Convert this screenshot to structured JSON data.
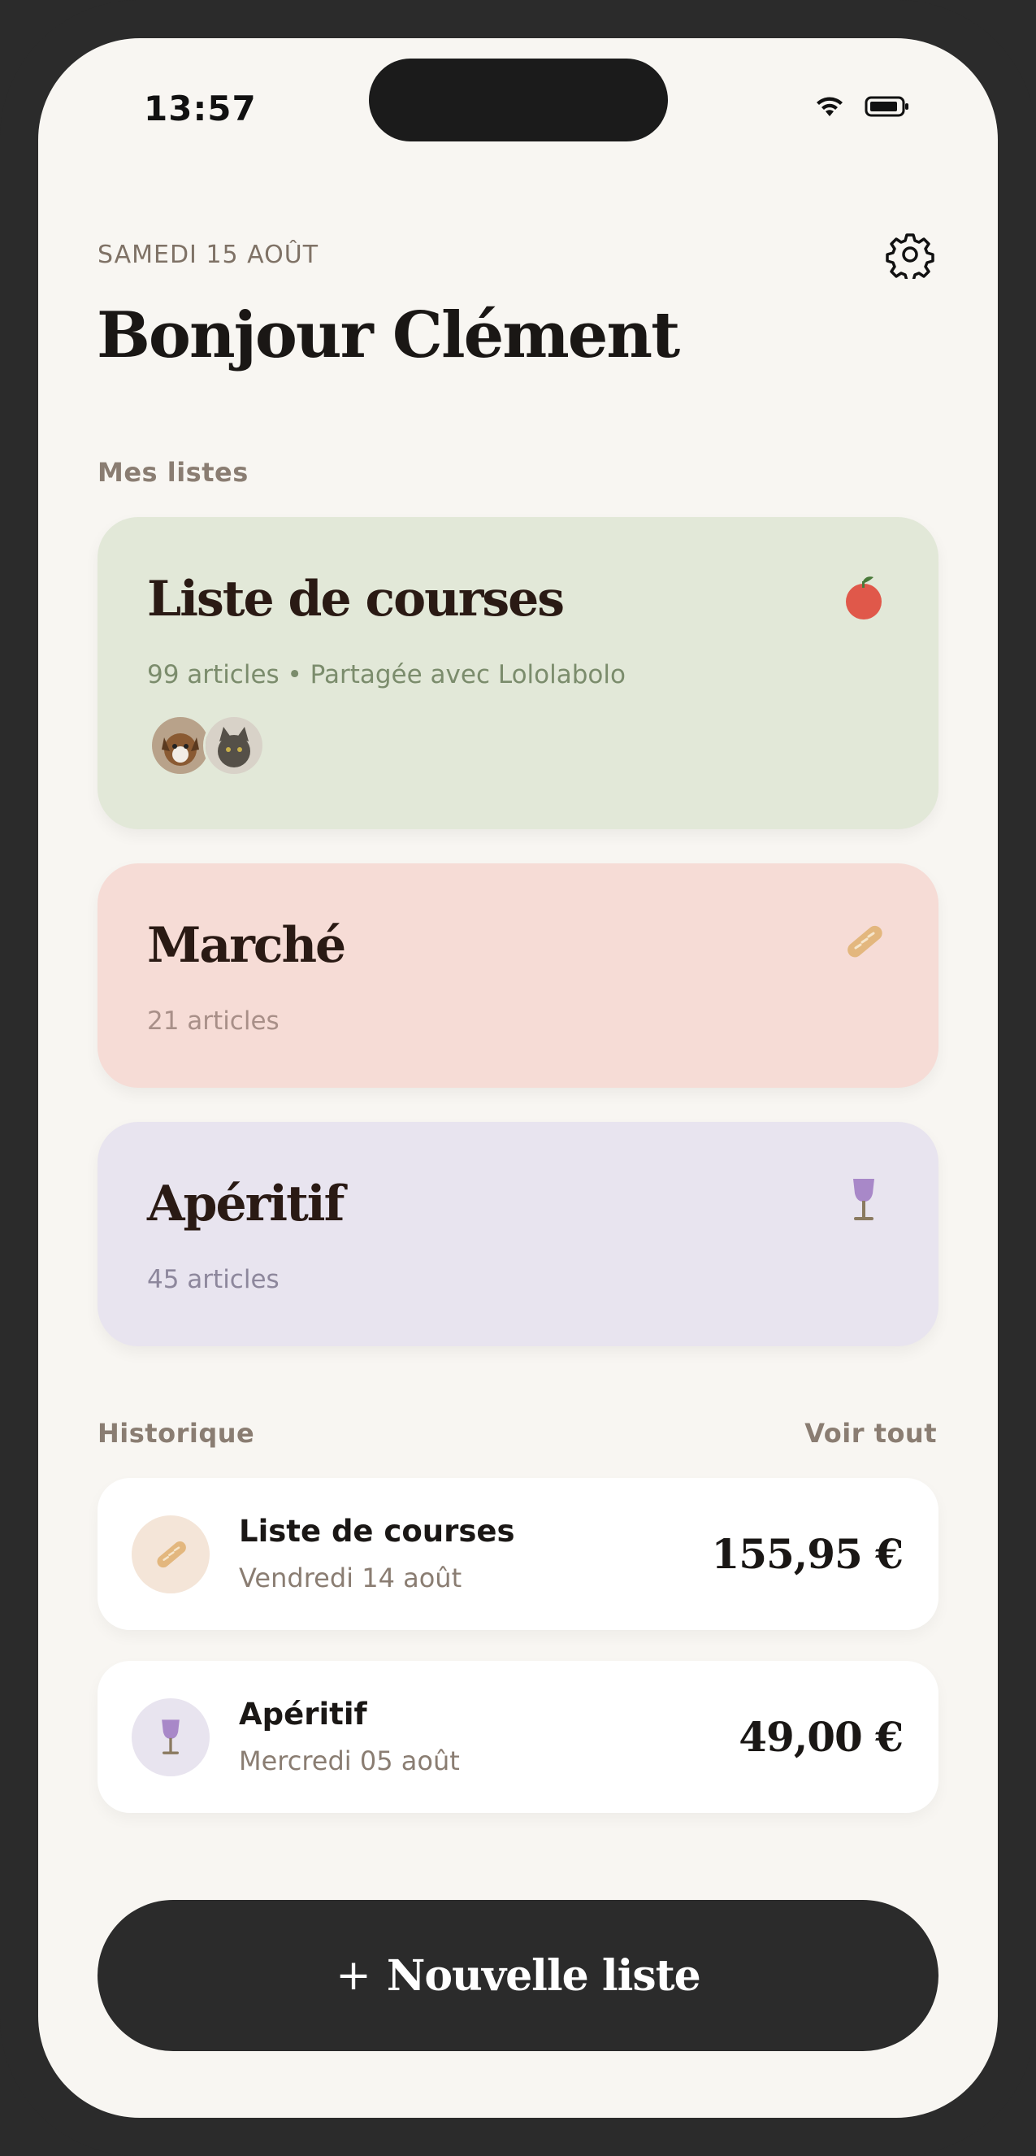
{
  "status_bar": {
    "time": "13:57"
  },
  "header": {
    "date": "SAMEDI 15 AOÛT",
    "greeting": "Bonjour Clément"
  },
  "lists_section": {
    "label": "Mes listes",
    "cards": [
      {
        "title": "Liste de courses",
        "subtitle": "99 articles • Partagée avec Lololabolo",
        "icon": "tomato-icon",
        "color": "#e2e8d8",
        "subtitle_color": "#7b8c6c"
      },
      {
        "title": "Marché",
        "subtitle": "21 articles",
        "icon": "baguette-icon",
        "color": "#f6dcd6",
        "subtitle_color": "#a88f88"
      },
      {
        "title": "Apéritif",
        "subtitle": "45 articles",
        "icon": "wine-glass-icon",
        "color": "#e8e4ef",
        "subtitle_color": "#8d879c"
      }
    ]
  },
  "history": {
    "label": "Historique",
    "see_all": "Voir tout",
    "items": [
      {
        "title": "Liste de courses",
        "date": "Vendredi 14 août",
        "amount": "155,95 €",
        "icon": "baguette-icon"
      },
      {
        "title": "Apéritif",
        "date": "Mercredi 05 août",
        "amount": "49,00 €",
        "icon": "wine-glass-icon"
      }
    ]
  },
  "new_list_button": {
    "label": "Nouvelle liste",
    "plus": "+"
  }
}
